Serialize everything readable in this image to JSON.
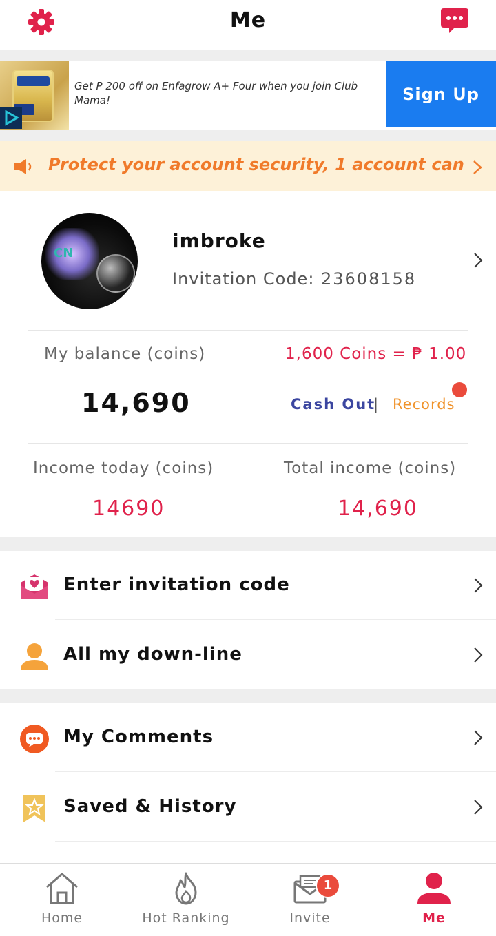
{
  "header": {
    "title": "Me",
    "settings_icon": "gear-icon",
    "messages_icon": "chat-bubble-icon",
    "accent": "#e0224b"
  },
  "ad": {
    "text": "Get P 200 off on Enfagrow A+ Four when you join Club Mama!",
    "cta": "Sign Up",
    "cta_color": "#1a7cf0",
    "image_brand": "Enfagrow",
    "image_sub": "A+",
    "image_badge": "MFGM PRO"
  },
  "notice": {
    "text": "Protect your account security, 1 account can only",
    "color": "#f07a2a",
    "icon": "speaker-icon"
  },
  "profile": {
    "username": "imbroke",
    "invitation_label": "Invitation Code:",
    "invitation_code": "23608158",
    "avatar_text": "CN"
  },
  "balance": {
    "label": "My balance (coins)",
    "value": "14,690",
    "rate": "1,600 Coins = ₱ 1.00",
    "cash_out": "Cash Out",
    "separator": "|",
    "records": "Records"
  },
  "income": {
    "today_label": "Income today (coins)",
    "today_value": "14690",
    "total_label": "Total income (coins)",
    "total_value": "14,690"
  },
  "menu": [
    {
      "label": "Enter invitation code",
      "icon": "envelope-heart-icon"
    },
    {
      "label": "All my down-line",
      "icon": "person-icon"
    },
    {
      "label": "My Comments",
      "icon": "comment-icon"
    },
    {
      "label": "Saved & History",
      "icon": "bookmark-star-icon"
    }
  ],
  "tabs": [
    {
      "label": "Home",
      "icon": "home-icon"
    },
    {
      "label": "Hot Ranking",
      "icon": "flame-icon"
    },
    {
      "label": "Invite",
      "icon": "mail-icon",
      "badge": "1"
    },
    {
      "label": "Me",
      "icon": "person-icon",
      "active": true
    }
  ]
}
